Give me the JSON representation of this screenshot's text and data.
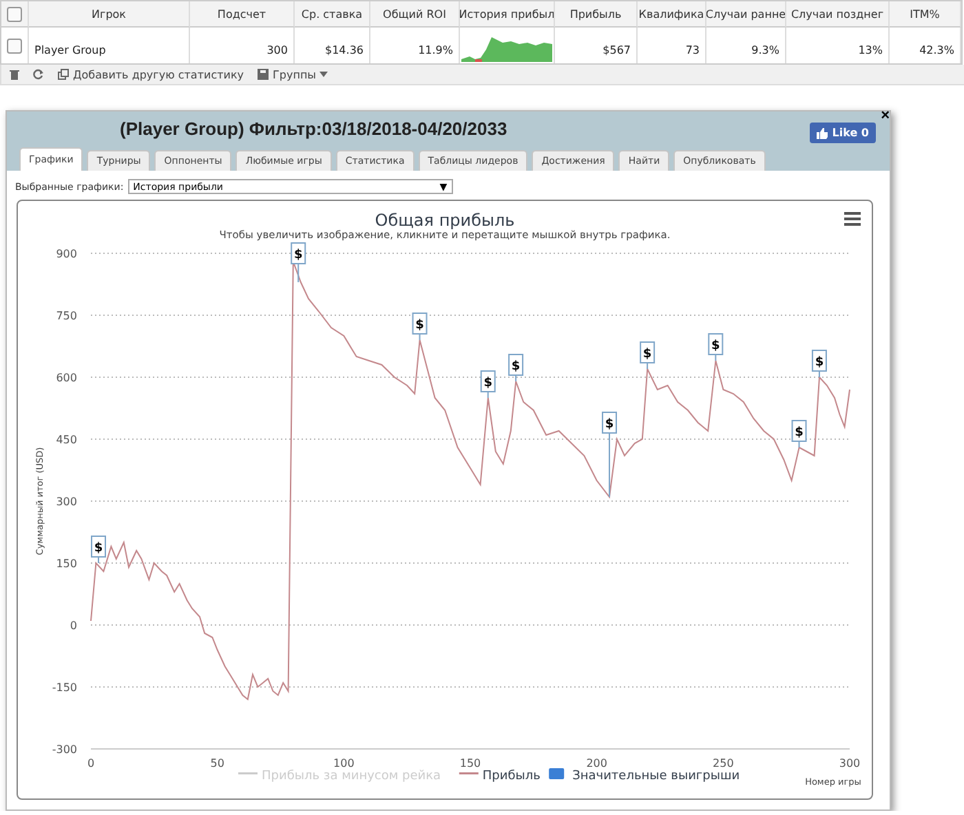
{
  "table": {
    "header_checkbox": {
      "checked": false
    },
    "columns": [
      "Игрок",
      "Подсчет",
      "Ср. ставка",
      "Общий ROI",
      "История прибыл",
      "Прибыль",
      "Квалифика",
      "Случаи ранне",
      "Случаи позднег",
      "ITM%"
    ],
    "rows": [
      {
        "checked": false,
        "cells": [
          {
            "kind": "text",
            "text": "Player Group"
          },
          {
            "kind": "text",
            "text": "300"
          },
          {
            "kind": "text",
            "text": "$14.36"
          },
          {
            "kind": "text",
            "text": "11.9%"
          },
          {
            "kind": "sparkline"
          },
          {
            "kind": "text",
            "text": "$567"
          },
          {
            "kind": "text",
            "text": "73"
          },
          {
            "kind": "text",
            "text": "9.3%"
          },
          {
            "kind": "text",
            "text": "13%"
          },
          {
            "kind": "text",
            "text": "42.3%"
          }
        ]
      }
    ]
  },
  "toolbar": {
    "add_stat": "Добавить другую статистику",
    "groups": "Группы"
  },
  "panel": {
    "title": "(Player Group) Фильтр:03/18/2018-04/20/2033",
    "like": "Like 0",
    "close": "×",
    "tabs": [
      {
        "label": "Графики",
        "selected": true
      },
      {
        "label": "Турниры",
        "selected": false
      },
      {
        "label": "Оппоненты",
        "selected": false
      },
      {
        "label": "Любимые игры",
        "selected": false
      },
      {
        "label": "Статистика",
        "selected": false
      },
      {
        "label": "Таблицы лидеров",
        "selected": false
      },
      {
        "label": "Достижения",
        "selected": false
      },
      {
        "label": "Найти",
        "selected": false
      },
      {
        "label": "Опубликовать",
        "selected": false
      }
    ],
    "chart_select": {
      "label": "Выбранные графики:",
      "value": "История прибыли",
      "caret": "▼"
    },
    "chart": {
      "subtitle": "Чтобы увеличить изображение, кликните и перетащите мышкой внутрь графика.",
      "legend": [
        {
          "label": "Прибыль за минусом рейка",
          "kind": "line",
          "visible": false,
          "color": "#cccccc"
        },
        {
          "kind": "series",
          "visible": true
        },
        {
          "label": "Значительные выигрыши",
          "kind": "flag",
          "visible": true,
          "color": "#3a7fd5"
        }
      ],
      "chart_data": {
        "type": "line",
        "grid": true,
        "title": "Общая прибыль",
        "xlabel": "Номер игры",
        "ylabel": "Суммарный итог (USD)",
        "xlim": [
          0,
          300
        ],
        "ylim": [
          -300,
          900
        ],
        "xticks": [
          0,
          50,
          100,
          150,
          200,
          250,
          300
        ],
        "yticks": [
          -300,
          -150,
          0,
          150,
          300,
          450,
          600,
          750,
          900
        ],
        "x": [
          0,
          2,
          5,
          8,
          10,
          13,
          15,
          18,
          20,
          23,
          25,
          28,
          30,
          33,
          35,
          38,
          40,
          43,
          45,
          48,
          50,
          53,
          55,
          58,
          60,
          62,
          64,
          66,
          68,
          70,
          72,
          74,
          76,
          78,
          80,
          83,
          86,
          90,
          95,
          100,
          105,
          110,
          115,
          120,
          125,
          128,
          130,
          133,
          136,
          140,
          145,
          150,
          154,
          157,
          160,
          163,
          166,
          168,
          171,
          175,
          180,
          185,
          190,
          195,
          200,
          205,
          208,
          211,
          215,
          218,
          220,
          224,
          228,
          232,
          236,
          240,
          244,
          247,
          250,
          254,
          258,
          262,
          266,
          270,
          274,
          277,
          280,
          283,
          286,
          288,
          291,
          294,
          296,
          298,
          300
        ],
        "series": [
          {
            "name": "Прибыль",
            "color": "#c4888c",
            "values": [
              10,
              150,
              130,
              190,
              160,
              200,
              140,
              180,
              160,
              110,
              150,
              130,
              120,
              80,
              100,
              60,
              40,
              20,
              -20,
              -30,
              -60,
              -100,
              -120,
              -150,
              -170,
              -180,
              -120,
              -150,
              -140,
              -130,
              -160,
              -170,
              -140,
              -160,
              880,
              830,
              790,
              760,
              720,
              700,
              650,
              640,
              630,
              600,
              580,
              560,
              690,
              620,
              550,
              520,
              430,
              380,
              340,
              550,
              420,
              390,
              470,
              590,
              540,
              520,
              460,
              470,
              440,
              410,
              350,
              310,
              450,
              410,
              440,
              450,
              620,
              570,
              580,
              540,
              520,
              490,
              470,
              640,
              570,
              560,
              540,
              500,
              470,
              450,
              400,
              350,
              430,
              420,
              410,
              600,
              580,
              550,
              510,
              480,
              570
            ]
          }
        ],
        "annotations": [
          {
            "x": 3,
            "y": 190,
            "text": "$"
          },
          {
            "x": 82,
            "y": 900,
            "text": "$"
          },
          {
            "x": 130,
            "y": 730,
            "text": "$"
          },
          {
            "x": 157,
            "y": 590,
            "text": "$"
          },
          {
            "x": 168,
            "y": 630,
            "text": "$"
          },
          {
            "x": 205,
            "y": 490,
            "text": "$"
          },
          {
            "x": 220,
            "y": 660,
            "text": "$"
          },
          {
            "x": 247,
            "y": 680,
            "text": "$"
          },
          {
            "x": 280,
            "y": 470,
            "text": "$"
          },
          {
            "x": 288,
            "y": 640,
            "text": "$"
          }
        ]
      }
    }
  }
}
